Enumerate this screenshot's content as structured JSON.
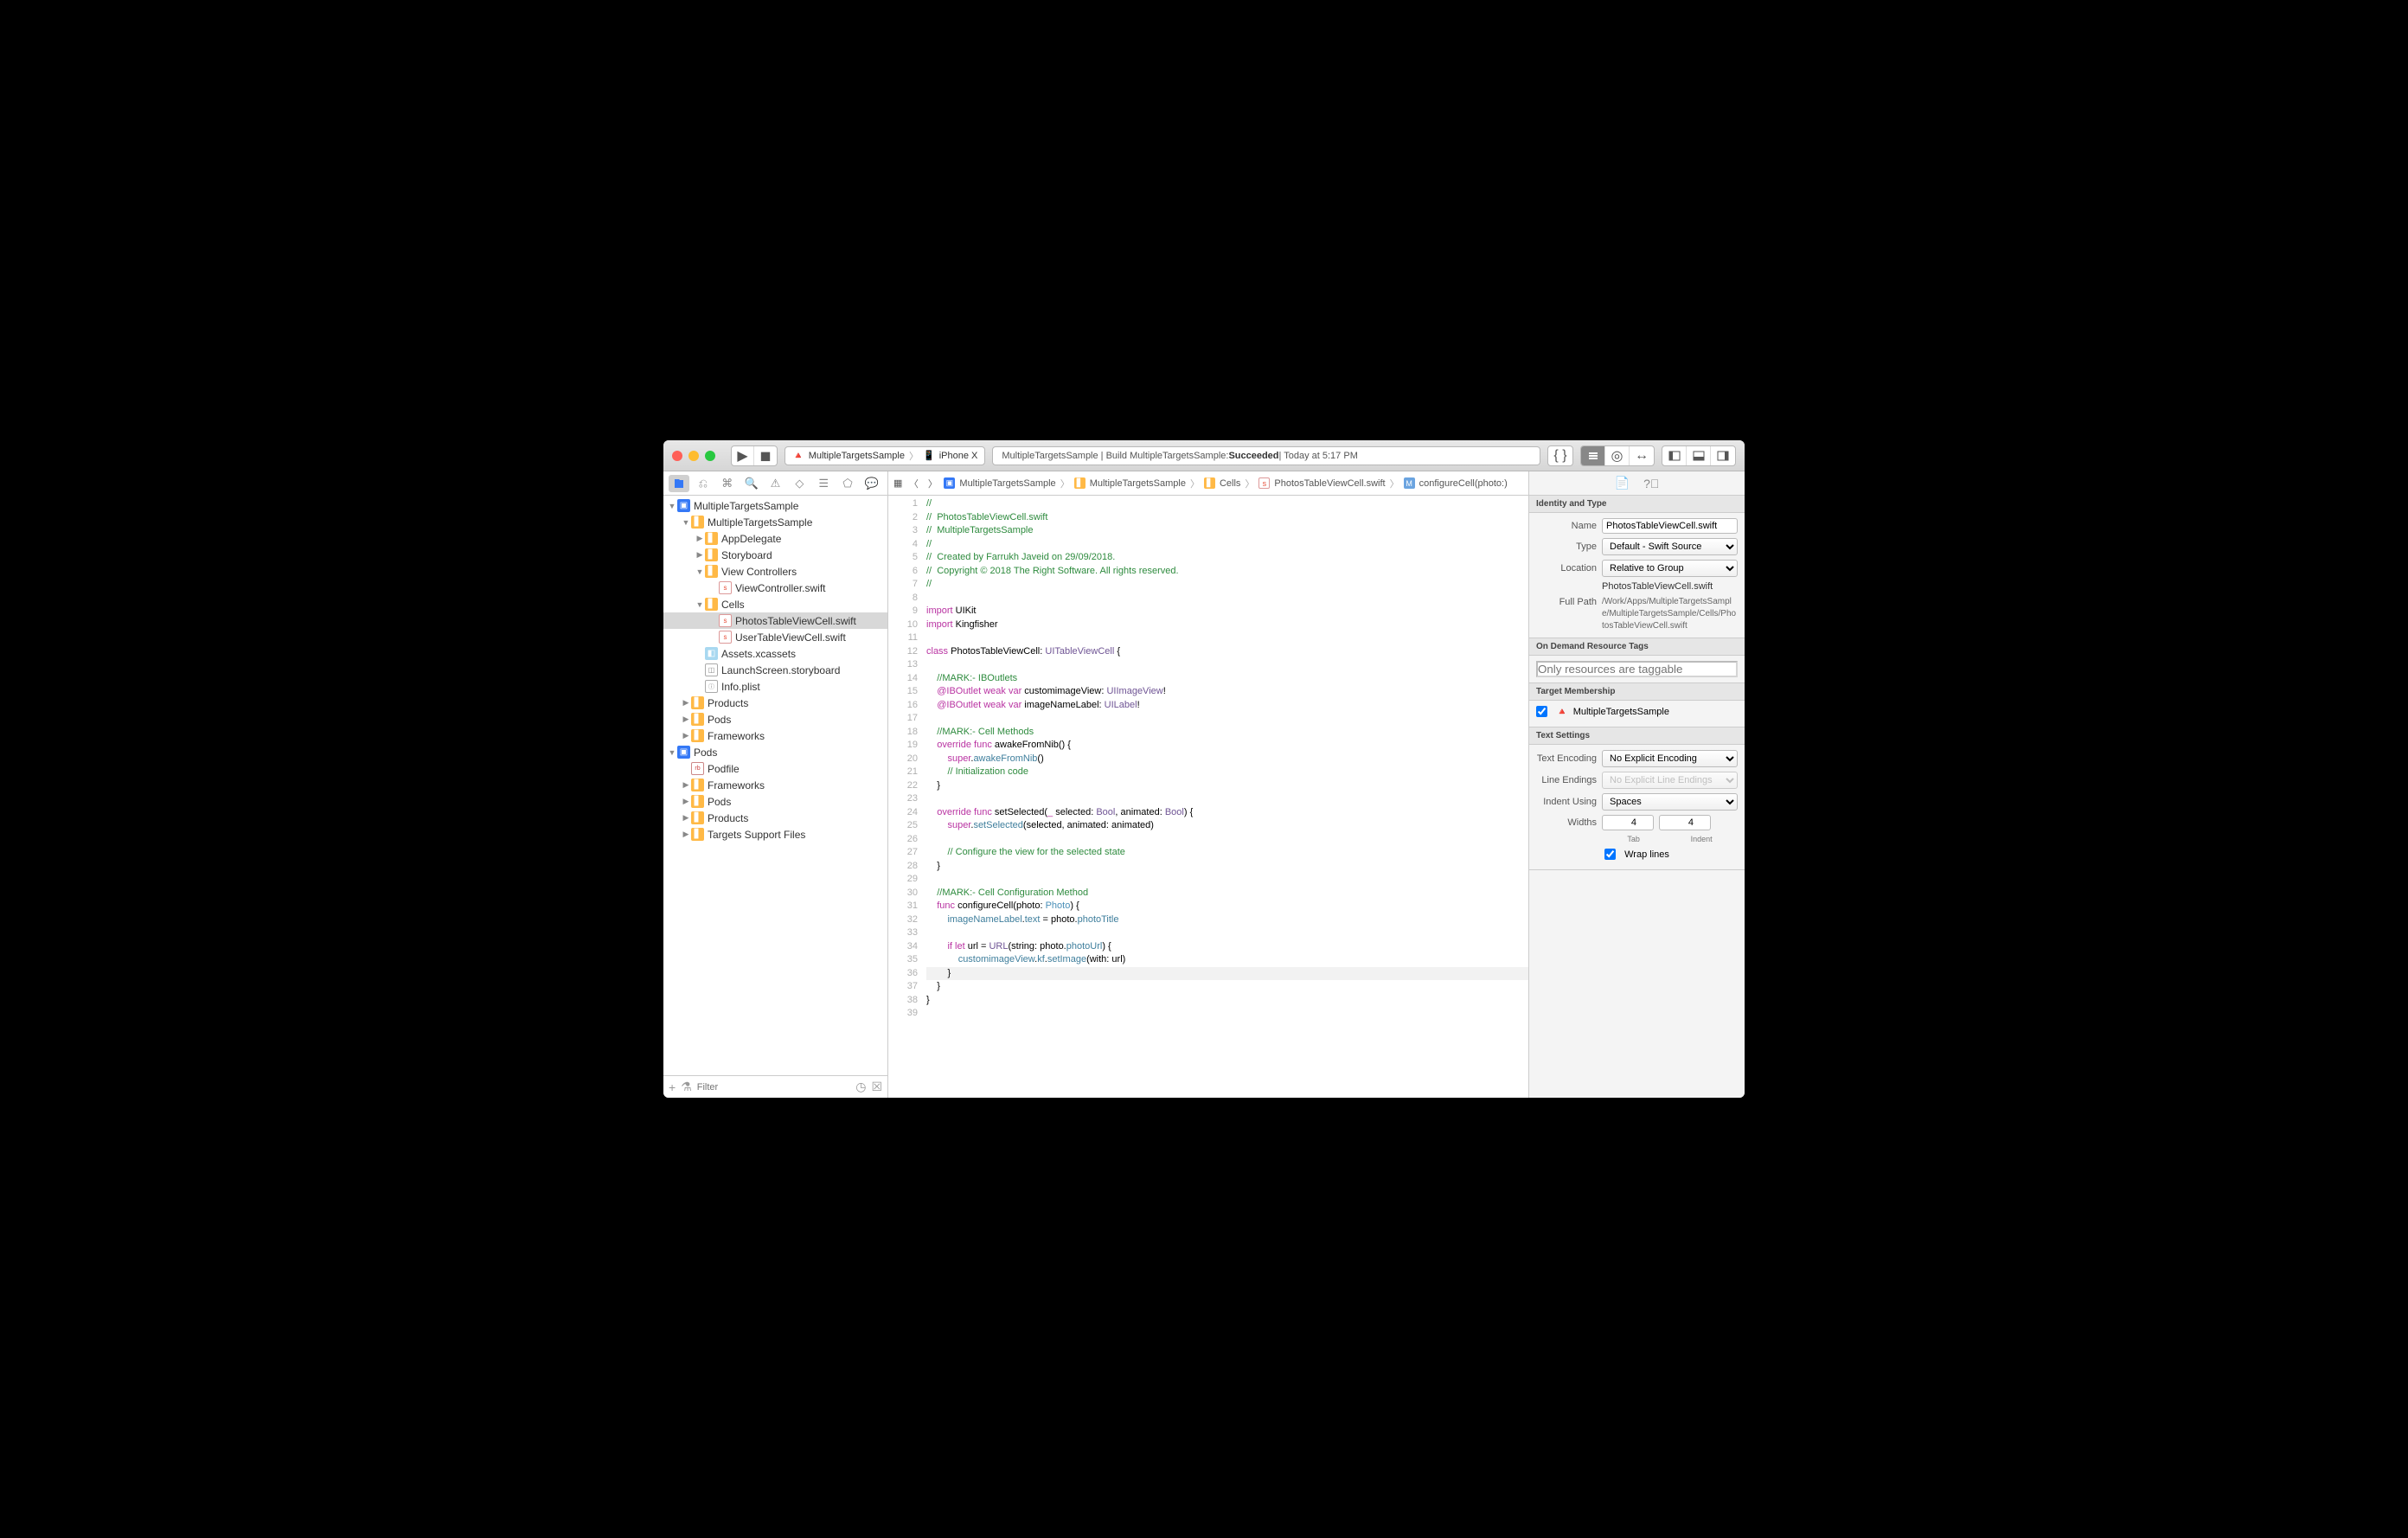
{
  "toolbar": {
    "scheme": "MultipleTargetsSample",
    "device": "iPhone X",
    "activity_prefix": "MultipleTargetsSample | Build MultipleTargetsSample: ",
    "activity_status": "Succeeded",
    "activity_time": " | Today at 5:17 PM"
  },
  "jumpbar": {
    "crumbs": [
      "MultipleTargetsSample",
      "MultipleTargetsSample",
      "Cells",
      "PhotosTableViewCell.swift",
      "configureCell(photo:)"
    ]
  },
  "navigator": {
    "filter_placeholder": "Filter",
    "tree": [
      {
        "d": 0,
        "disc": "▼",
        "icon": "proj",
        "label": "MultipleTargetsSample"
      },
      {
        "d": 1,
        "disc": "▼",
        "icon": "folder",
        "label": "MultipleTargetsSample"
      },
      {
        "d": 2,
        "disc": "▶",
        "icon": "folder",
        "label": "AppDelegate"
      },
      {
        "d": 2,
        "disc": "▶",
        "icon": "folder",
        "label": "Storyboard"
      },
      {
        "d": 2,
        "disc": "▼",
        "icon": "folder",
        "label": "View Controllers"
      },
      {
        "d": 3,
        "disc": "",
        "icon": "swift",
        "label": "ViewController.swift"
      },
      {
        "d": 2,
        "disc": "▼",
        "icon": "folder",
        "label": "Cells"
      },
      {
        "d": 3,
        "disc": "",
        "icon": "swift",
        "label": "PhotosTableViewCell.swift",
        "selected": true
      },
      {
        "d": 3,
        "disc": "",
        "icon": "swift",
        "label": "UserTableViewCell.swift"
      },
      {
        "d": 2,
        "disc": "",
        "icon": "asset",
        "label": "Assets.xcassets"
      },
      {
        "d": 2,
        "disc": "",
        "icon": "sb",
        "label": "LaunchScreen.storyboard"
      },
      {
        "d": 2,
        "disc": "",
        "icon": "plist",
        "label": "Info.plist"
      },
      {
        "d": 1,
        "disc": "▶",
        "icon": "folder",
        "label": "Products"
      },
      {
        "d": 1,
        "disc": "▶",
        "icon": "folder",
        "label": "Pods"
      },
      {
        "d": 1,
        "disc": "▶",
        "icon": "folder",
        "label": "Frameworks"
      },
      {
        "d": 0,
        "disc": "▼",
        "icon": "proj",
        "label": "Pods"
      },
      {
        "d": 1,
        "disc": "",
        "icon": "pod",
        "label": "Podfile"
      },
      {
        "d": 1,
        "disc": "▶",
        "icon": "folder",
        "label": "Frameworks"
      },
      {
        "d": 1,
        "disc": "▶",
        "icon": "folder",
        "label": "Pods"
      },
      {
        "d": 1,
        "disc": "▶",
        "icon": "folder",
        "label": "Products"
      },
      {
        "d": 1,
        "disc": "▶",
        "icon": "folder",
        "label": "Targets Support Files"
      }
    ]
  },
  "code": {
    "lines": [
      {
        "n": 1,
        "t": "c",
        "s": "//"
      },
      {
        "n": 2,
        "t": "c",
        "s": "//  PhotosTableViewCell.swift"
      },
      {
        "n": 3,
        "t": "c",
        "s": "//  MultipleTargetsSample"
      },
      {
        "n": 4,
        "t": "c",
        "s": "//"
      },
      {
        "n": 5,
        "t": "c",
        "s": "//  Created by Farrukh Javeid on 29/09/2018."
      },
      {
        "n": 6,
        "t": "c",
        "s": "//  Copyright © 2018 The Right Software. All rights reserved."
      },
      {
        "n": 7,
        "t": "c",
        "s": "//"
      },
      {
        "n": 8,
        "t": "",
        "s": ""
      },
      {
        "n": 9,
        "t": "h",
        "h": "<span class='c-keyword'>import</span> UIKit"
      },
      {
        "n": 10,
        "t": "h",
        "h": "<span class='c-keyword'>import</span> Kingfisher"
      },
      {
        "n": 11,
        "t": "",
        "s": ""
      },
      {
        "n": 12,
        "t": "h",
        "h": "<span class='c-keyword'>class</span> PhotosTableViewCell: <span class='c-type2'>UITableViewCell</span> {"
      },
      {
        "n": 13,
        "t": "",
        "s": ""
      },
      {
        "n": 14,
        "t": "h",
        "h": "    <span class='c-comment'>//MARK:- IBOutlets</span>"
      },
      {
        "n": 15,
        "t": "h",
        "ib": true,
        "h": "    <span class='c-attr'>@IBOutlet</span> <span class='c-keyword'>weak</span> <span class='c-keyword'>var</span> customimageView: <span class='c-type2'>UIImageView</span>!"
      },
      {
        "n": 16,
        "t": "h",
        "ib": true,
        "h": "    <span class='c-attr'>@IBOutlet</span> <span class='c-keyword'>weak</span> <span class='c-keyword'>var</span> imageNameLabel: <span class='c-type2'>UILabel</span>!"
      },
      {
        "n": 17,
        "t": "",
        "s": ""
      },
      {
        "n": 18,
        "t": "h",
        "h": "    <span class='c-comment'>//MARK:- Cell Methods</span>"
      },
      {
        "n": 19,
        "t": "h",
        "h": "    <span class='c-keyword'>override</span> <span class='c-keyword'>func</span> awakeFromNib() {"
      },
      {
        "n": 20,
        "t": "h",
        "h": "        <span class='c-keyword'>super</span>.<span class='c-method'>awakeFromNib</span>()"
      },
      {
        "n": 21,
        "t": "h",
        "h": "        <span class='c-comment'>// Initialization code</span>"
      },
      {
        "n": 22,
        "t": "",
        "s": "    }"
      },
      {
        "n": 23,
        "t": "",
        "s": ""
      },
      {
        "n": 24,
        "t": "h",
        "h": "    <span class='c-keyword'>override</span> <span class='c-keyword'>func</span> setSelected(<span class='c-keyword'>_</span> selected: <span class='c-type2'>Bool</span>, animated: <span class='c-type2'>Bool</span>) {"
      },
      {
        "n": 25,
        "t": "h",
        "h": "        <span class='c-keyword'>super</span>.<span class='c-method'>setSelected</span>(selected, animated: animated)"
      },
      {
        "n": 26,
        "t": "",
        "s": ""
      },
      {
        "n": 27,
        "t": "h",
        "h": "        <span class='c-comment'>// Configure the view for the selected state</span>"
      },
      {
        "n": 28,
        "t": "",
        "s": "    }"
      },
      {
        "n": 29,
        "t": "",
        "s": ""
      },
      {
        "n": 30,
        "t": "h",
        "h": "    <span class='c-comment'>//MARK:- Cell Configuration Method</span>"
      },
      {
        "n": 31,
        "t": "h",
        "h": "    <span class='c-keyword'>func</span> configureCell(photo: <span class='c-type'>Photo</span>) {"
      },
      {
        "n": 32,
        "t": "h",
        "h": "        <span class='c-prop'>imageNameLabel</span>.<span class='c-prop'>text</span> = photo.<span class='c-prop'>photoTitle</span>"
      },
      {
        "n": 33,
        "t": "",
        "s": ""
      },
      {
        "n": 34,
        "t": "h",
        "h": "        <span class='c-keyword'>if</span> <span class='c-keyword'>let</span> url = <span class='c-type2'>URL</span>(string: photo.<span class='c-prop'>photoUrl</span>) {"
      },
      {
        "n": 35,
        "t": "h",
        "h": "            <span class='c-prop'>customimageView</span>.<span class='c-prop'>kf</span>.<span class='c-method'>setImage</span>(with: url)"
      },
      {
        "n": 36,
        "t": "",
        "s": "        }",
        "hl": true
      },
      {
        "n": 37,
        "t": "",
        "s": "    }"
      },
      {
        "n": 38,
        "t": "",
        "s": "}"
      },
      {
        "n": 39,
        "t": "",
        "s": ""
      }
    ]
  },
  "inspector": {
    "identity_header": "Identity and Type",
    "name_label": "Name",
    "name_value": "PhotosTableViewCell.swift",
    "type_label": "Type",
    "type_value": "Default - Swift Source",
    "location_label": "Location",
    "location_value": "Relative to Group",
    "location_sub": "PhotosTableViewCell.swift",
    "fullpath_label": "Full Path",
    "fullpath_value": "/Work/Apps/MultipleTargetsSample/MultipleTargetsSample/Cells/PhotosTableViewCell.swift",
    "odr_header": "On Demand Resource Tags",
    "odr_placeholder": "Only resources are taggable",
    "target_header": "Target Membership",
    "target_name": "MultipleTargetsSample",
    "text_header": "Text Settings",
    "encoding_label": "Text Encoding",
    "encoding_value": "No Explicit Encoding",
    "lineend_label": "Line Endings",
    "lineend_value": "No Explicit Line Endings",
    "indent_label": "Indent Using",
    "indent_value": "Spaces",
    "widths_label": "Widths",
    "tab_width": "4",
    "indent_width": "4",
    "tab_label": "Tab",
    "indent_width_label": "Indent",
    "wrap_label": "Wrap lines"
  }
}
